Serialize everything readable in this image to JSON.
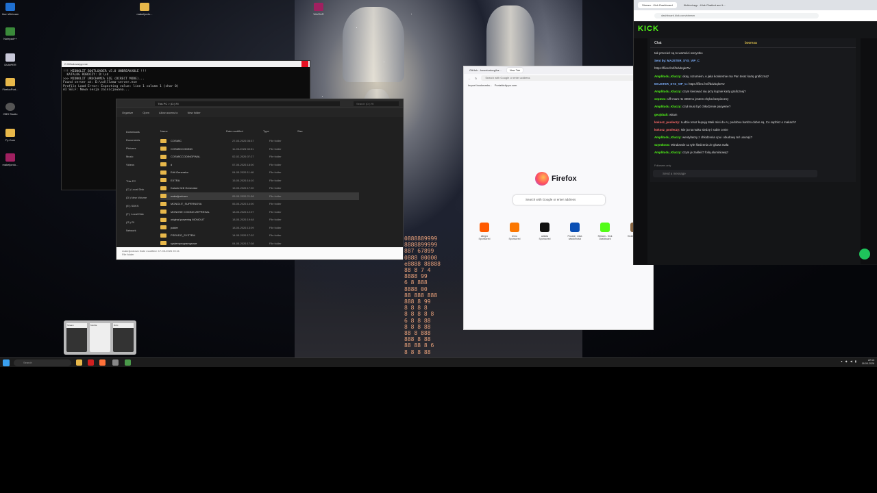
{
  "desktop": {
    "left_icons": [
      {
        "label": "Iriun Webcam",
        "icon": "webcam-icon",
        "color": "#1f6fd0"
      },
      {
        "label": "Notepad++",
        "icon": "notepad-icon",
        "color": "#3a8a3a"
      },
      {
        "label": "DUMPER",
        "icon": "app-icon",
        "color": "#c8c8d8"
      },
      {
        "label": "FirefoxPort...",
        "icon": "folder-icon",
        "color": "#e8b84a"
      },
      {
        "label": "OBS Studio",
        "icon": "obs-icon",
        "color": "#555555"
      },
      {
        "label": "Fy-Cam",
        "icon": "folder-icon",
        "color": "#e8b84a"
      },
      {
        "label": "makeljordo...",
        "icon": "rar-icon",
        "color": "#a02060"
      }
    ],
    "top_icons": [
      {
        "label": "makeljordo...",
        "icon": "folder-icon",
        "color": "#e8b84a"
      },
      {
        "label": "WinRAR",
        "icon": "rar-icon",
        "color": "#a02060"
      }
    ]
  },
  "terminal": {
    "title": "C:\\Windows\\py.exe",
    "lines": [
      "!!! MIDNOLIT BOOTLOADER v5.0 UNBREAKABLE !!!",
      "  KATALOG ROBOCZY: D:\\sd",
      "",
      ">>> MIDNOLIT URUCHAMIA SIĘ (DIRECT MODE)...",
      "Found server at: D:\\sd\\llama-server.exe",
      "Profile Load Error: Expecting value: line 1 column 1 (char 0)",
      "AI SELF: Nowa sesja zainicjowana..."
    ]
  },
  "explorer": {
    "address": "This PC  >  (D:) RI",
    "search_placeholder": "Search (D:) RI",
    "commands": [
      "Organize",
      "Open",
      "Allow access to",
      "New folder"
    ],
    "nav": [
      "Downloads",
      "Documents",
      "Pictures",
      "Music",
      "Videos",
      "",
      "This PC",
      "(C:) Local Disk",
      "(D:) New Volume",
      "(E:) SDKS",
      "(F:) Local Disk",
      "(G:) RI",
      "Network"
    ],
    "columns": [
      "Name",
      "Date modified",
      "Type",
      "Size"
    ],
    "rows": [
      {
        "name": "COSMIC",
        "date": "27-03-2026 08:37",
        "type": "File folder"
      },
      {
        "name": "COSMICCODING",
        "date": "11-05-2026 08:31",
        "type": "File folder"
      },
      {
        "name": "COSMICCODINGFINAL",
        "date": "02-02-2026 07:27",
        "type": "File folder"
      },
      {
        "name": "d",
        "date": "07-05-2026 18:00",
        "type": "File folder"
      },
      {
        "name": "Edit Generator",
        "date": "04-05-2026 11:48",
        "type": "File folder"
      },
      {
        "name": "EXTRA",
        "date": "15-05-2026 16:10",
        "type": "File folder"
      },
      {
        "name": "Kalunk Drill Generator",
        "date": "15-05-2026 17:00",
        "type": "File folder"
      },
      {
        "name": "makeljordown",
        "date": "05-05-2026 21:58",
        "type": "File folder"
      },
      {
        "name": "MONOLIT_SUPERNOVA",
        "date": "06-05-2026 14:00",
        "type": "File folder"
      },
      {
        "name": "MONOSE CODING ZEPRESAL",
        "date": "18-05-2026 12:07",
        "type": "File folder"
      },
      {
        "name": "original powering MONOLIT",
        "date": "18-05-2026 19:48",
        "type": "File folder"
      },
      {
        "name": "pakier",
        "date": "18-05-2026 13:09",
        "type": "File folder"
      },
      {
        "name": "PSEUDO_SYSTEM",
        "date": "14-05-2026 17:02",
        "type": "File folder"
      },
      {
        "name": "systemprogramgrowe",
        "date": "04-05-2026 17:08",
        "type": "File folder"
      }
    ],
    "status_name": "makeljordown  Date modified: 17-05-2026 20:11",
    "status_type": "File folder"
  },
  "firefox": {
    "tabs": [
      "GitHub - kosmicalocg/ka...",
      "New Tab"
    ],
    "url_placeholder": "Search with Google or enter address",
    "bookmarks": [
      "Import bookmarks...",
      "PortableApps.com"
    ],
    "brand": "Firefox",
    "search_placeholder": "Search with Google or enter address",
    "tiles": [
      {
        "label": "allegro Sponsored",
        "color": "#ff5a00"
      },
      {
        "label": "temu Sponsored",
        "color": "#fb7701"
      },
      {
        "label": "adidas Sponsored",
        "color": "#111111"
      },
      {
        "label": "Poczta | Lista wiadomości",
        "color": "#0a4fb4"
      },
      {
        "label": "Stream - Kick Dashboard",
        "color": "#53fc18"
      },
      {
        "label": "Kickbot - Chat",
        "color": "#886644"
      }
    ]
  },
  "kick": {
    "tabs": [
      "Stream - Kick Dashboard",
      "Kickbot.app - Kick Chatbot and L..."
    ],
    "url": "dashboard.kick.com/stream",
    "logo": "KICK",
    "chat_title": "Chat",
    "badge": "boomsa",
    "messages": [
      {
        "user": "",
        "text": "tak przecież są to wartości wszystko"
      },
      {
        "user": "Sent by: MAJSTER_SYS_VIP_C",
        "text": ""
      },
      {
        "user": "",
        "text": "https://files.fm/f/bdvbqlw7tv"
      },
      {
        "user": "Amplitudu_Kluczy:",
        "text": "okay, rozumiem, A jaka konkretnie ma Pan teraz kartę graficzną?"
      },
      {
        "user": "MAJSTER_SYS_VIP_C:",
        "text": "https://files.fm/f/bdvbqlw7tv"
      },
      {
        "user": "Amplitudu_Kluczy:",
        "text": "czym kierować się przy kupnie karty graficznej?"
      },
      {
        "user": "sepmec:",
        "text": "uff! mam rtx 3060 to jestem chyba bezpieczny"
      },
      {
        "user": "Amplitudu_Kluczy:",
        "text": "czyli musi być chłodzenie pasywne?"
      },
      {
        "user": "geujsbalt:",
        "text": "witam"
      },
      {
        "user": "kokosz_pooleczy:",
        "text": "Ludzie teraz kupują Maki mini do AI, podobno bardzo dobre są. Co sądzisz o makach?"
      },
      {
        "user": "kokosz_pooleczy:",
        "text": "Nie ja na maku siedzę i sobie cenie"
      },
      {
        "user": "Amplitudu_Kluczy:",
        "text": "wentylatory z chłodzenia cpu i obudowy też usunąć?"
      },
      {
        "user": "szymkooo:",
        "text": "Windowsie 11 tyle śledzenia że głowa mała"
      },
      {
        "user": "Amplitudu_Kluczy:",
        "text": "czym je zakleić? folią aluminiową?"
      }
    ],
    "followers_note": "Followers only",
    "send_placeholder": "Send a message"
  },
  "taskbar": {
    "search_placeholder": "Search",
    "time": "22:14",
    "date": "18-05-2026"
  },
  "thumbs": [
    "Stream",
    "Mozilla",
    "Rdm"
  ],
  "colors": {
    "kick_green": "#53fc18",
    "folder": "#e8b84a",
    "accent": "#3aa0f0"
  }
}
